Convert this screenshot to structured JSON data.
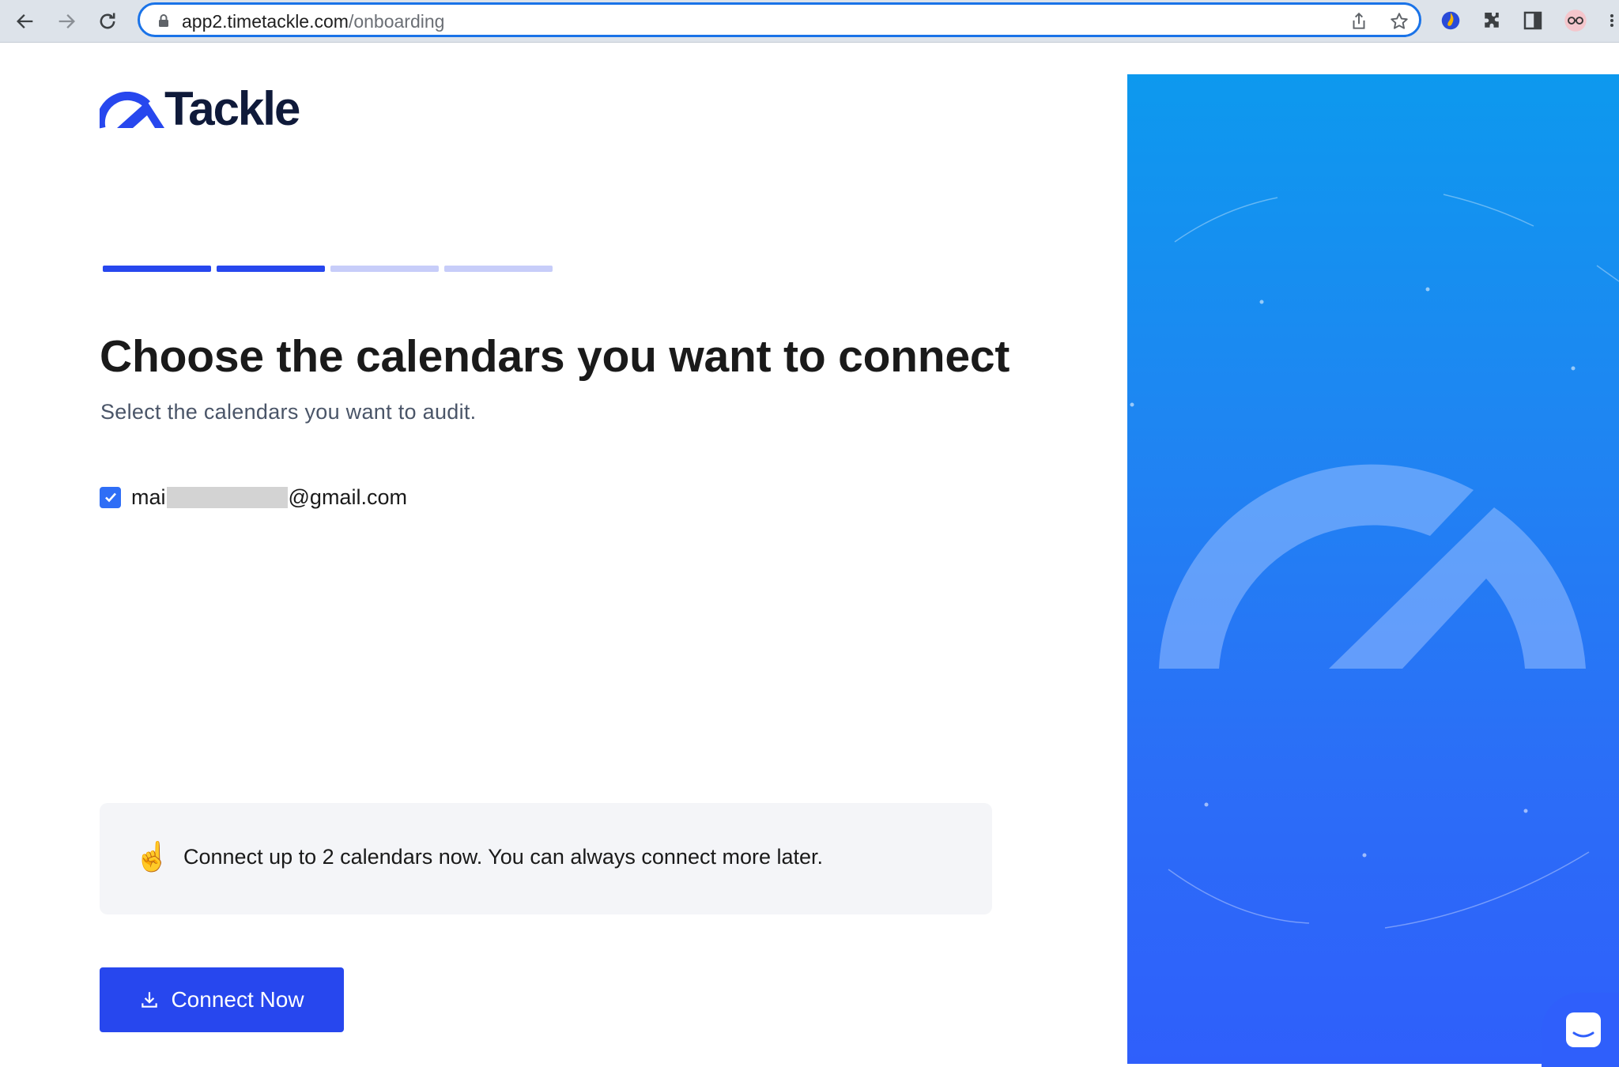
{
  "browser": {
    "url_host": "app2.timetackle.com",
    "url_path": "/onboarding"
  },
  "app": {
    "logo_text": "Tackle"
  },
  "onboarding": {
    "steps_total": 4,
    "steps_completed": 2,
    "colors": {
      "step_done": "#2747ee",
      "step_todo": "#c7cdf9"
    },
    "title": "Choose the calendars you want to connect",
    "subtitle": "Select the calendars you want to audit.",
    "calendars": [
      {
        "label_prefix": "mai",
        "label_suffix": "@gmail.com",
        "checked": true
      }
    ],
    "note": {
      "emoji": "☝️",
      "text": "Connect up to 2 calendars now. You can always connect more later."
    },
    "connect_button": {
      "label": "Connect Now",
      "icon": "download-icon"
    }
  },
  "theme": {
    "accent": "#2747ee",
    "hero_top": "#0d99ee",
    "hero_bottom": "#2f5ffb"
  }
}
